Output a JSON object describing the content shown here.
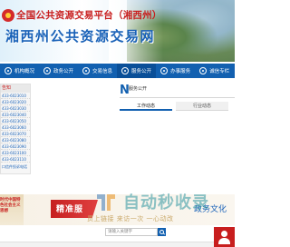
{
  "header": {
    "title_line1": "全国公共资源交易平台（湘西州）",
    "title_line2": "湘西州公共资源交易网"
  },
  "nav": {
    "items": [
      {
        "label": "机构概况",
        "icon": "building-icon"
      },
      {
        "label": "政务公开",
        "icon": "document-icon"
      },
      {
        "label": "交易信息",
        "icon": "list-icon"
      },
      {
        "label": "服务公开",
        "icon": "service-icon"
      },
      {
        "label": "办事服务",
        "icon": "handshake-icon"
      },
      {
        "label": "诚信专栏",
        "icon": "shield-icon"
      }
    ]
  },
  "notice": {
    "heading": "告知",
    "items": [
      "433-6023010",
      "433-6023020",
      "433-6023030",
      "433-6023040",
      "433-6023050",
      "433-6023060",
      "433-6023070",
      "433-6023080",
      "433-6023090",
      "433-6023100",
      "433-6023110"
    ],
    "footer": "口信件投诉电话"
  },
  "service_panel": {
    "big_letter": "N",
    "heading": "服务公开",
    "tabs": [
      "工作动态",
      "行业动态"
    ]
  },
  "banner": {
    "party_text": "时代中国特色社会主义思想",
    "red_text": "精准服",
    "sub_text": "贯上链接 来访一次 一心动改",
    "right_text": "政务文化"
  },
  "watermark": {
    "text": "自动秒收录"
  },
  "search": {
    "placeholder": "请输入关键字"
  }
}
